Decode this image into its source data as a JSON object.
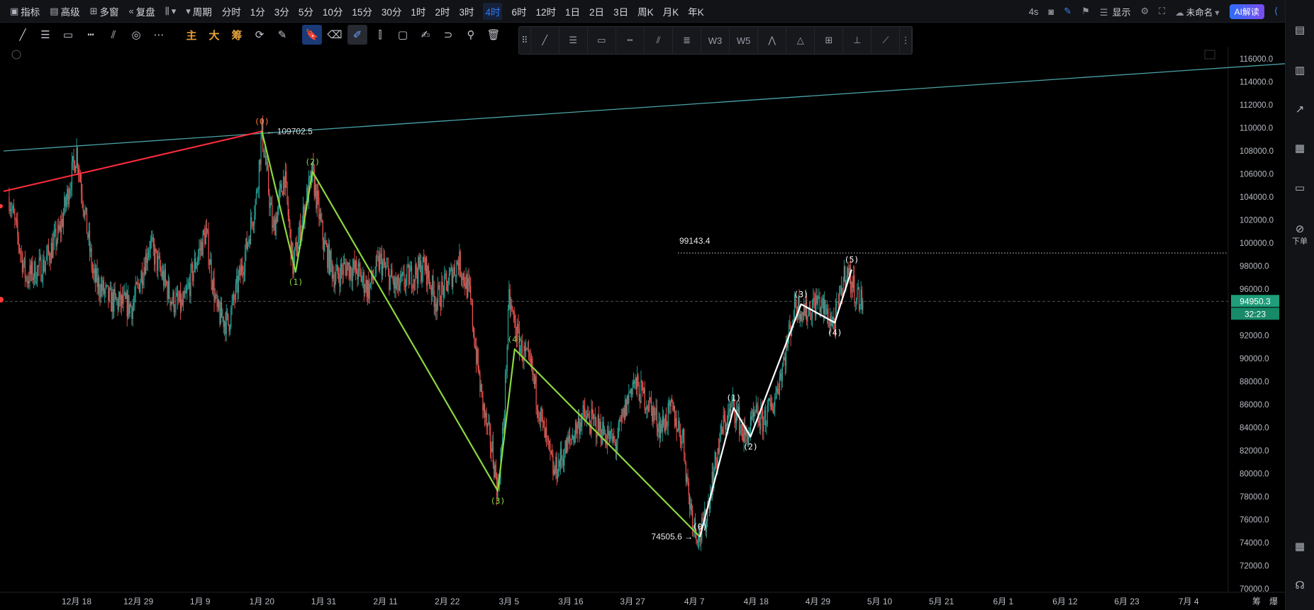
{
  "topbar": {
    "left_items": [
      {
        "icon": "indicator-icon",
        "label": "指标"
      },
      {
        "icon": "calendar-icon",
        "label": "高级"
      },
      {
        "icon": "grid-icon",
        "label": "多窗"
      },
      {
        "icon": "rewind-icon",
        "label": "复盘"
      },
      {
        "icon": "candle-type-icon",
        "label": ""
      },
      {
        "icon": "chevron-down-icon",
        "label": "周期"
      }
    ],
    "periods": [
      "分时",
      "1分",
      "3分",
      "5分",
      "10分",
      "15分",
      "30分",
      "1时",
      "2时",
      "3时",
      "4时",
      "6时",
      "12时",
      "1日",
      "2日",
      "3日",
      "周K",
      "月K",
      "年K"
    ],
    "active_period": "4时",
    "right": {
      "countdown": "4s",
      "display_label": "显示",
      "layout_name": "未命名",
      "ai_label": "AI解读"
    }
  },
  "toolbar": {
    "text_tools": [
      "主",
      "大",
      "筹"
    ],
    "icons": [
      "line-icon",
      "horizontal-lines-icon",
      "rectangle-icon",
      "ruler-icon",
      "fib-icon",
      "spiral-icon",
      "more-icon",
      "cycle-icon",
      "pen-icon",
      "bookmark-icon",
      "eraser-icon",
      "brush-icon",
      "bars-icon",
      "clipboard-icon",
      "note-icon",
      "magnet-icon",
      "filter-icon",
      "trash-icon"
    ]
  },
  "draw_panel": {
    "tools": [
      "drag-handle-icon",
      "trend-line-icon",
      "parallel-lines-icon",
      "rectangle-icon",
      "price-range-icon",
      "fib-retracement-icon",
      "fib-levels-icon",
      "wave3-icon",
      "wave5-icon",
      "pattern-icon",
      "triangle-icon",
      "crosshair-box-icon",
      "measure-icon",
      "ray-icon",
      "panel-more-icon"
    ]
  },
  "sidebar": {
    "items": [
      {
        "icon": "layout-icon",
        "label": ""
      },
      {
        "icon": "bar-chart-icon",
        "label": ""
      },
      {
        "icon": "trend-icon",
        "label": ""
      },
      {
        "icon": "chart-box-icon",
        "label": ""
      },
      {
        "icon": "depth-icon",
        "label": ""
      },
      {
        "icon": "order-icon",
        "label": "下单"
      },
      {
        "icon": "panel-icon",
        "label": ""
      },
      {
        "icon": "headset-icon",
        "label": ""
      }
    ]
  },
  "colors": {
    "up": "#26a69a",
    "down": "#ef5350",
    "green_wave": "#8bd83f",
    "white_wave": "#ffffff",
    "trend_red": "#ff2d3d",
    "trend_teal": "#4aa3a8",
    "price_badge": "#1f9e7a"
  },
  "chart_data": {
    "type": "candlestick",
    "ylim": [
      70000,
      116000
    ],
    "y_ticks": [
      70000,
      72000,
      74000,
      76000,
      78000,
      80000,
      82000,
      84000,
      86000,
      88000,
      90000,
      92000,
      94000,
      96000,
      98000,
      100000,
      102000,
      104000,
      106000,
      108000,
      110000,
      112000,
      114000,
      116000
    ],
    "x_ticks": [
      {
        "label": "12月 18",
        "day": 0
      },
      {
        "label": "12月 29",
        "day": 11
      },
      {
        "label": "1月 9",
        "day": 22
      },
      {
        "label": "1月 20",
        "day": 33
      },
      {
        "label": "1月 31",
        "day": 44
      },
      {
        "label": "2月 11",
        "day": 55
      },
      {
        "label": "2月 22",
        "day": 66
      },
      {
        "label": "3月 5",
        "day": 77
      },
      {
        "label": "3月 16",
        "day": 88
      },
      {
        "label": "3月 27",
        "day": 99
      },
      {
        "label": "4月 7",
        "day": 110
      },
      {
        "label": "4月 18",
        "day": 121
      },
      {
        "label": "4月 29",
        "day": 132
      },
      {
        "label": "5月 10",
        "day": 143
      },
      {
        "label": "5月 21",
        "day": 154
      },
      {
        "label": "6月 1",
        "day": 165
      },
      {
        "label": "6月 12",
        "day": 176
      },
      {
        "label": "6月 23",
        "day": 187
      },
      {
        "label": "7月 4",
        "day": 198
      }
    ],
    "x_extra_labels": [
      "筹",
      "爆"
    ],
    "price_path": [
      [
        -12,
        104000
      ],
      [
        -9,
        97000
      ],
      [
        -6,
        98000
      ],
      [
        -3,
        101000
      ],
      [
        0,
        108000
      ],
      [
        3,
        97000
      ],
      [
        6,
        95000
      ],
      [
        10,
        94500
      ],
      [
        13,
        100000
      ],
      [
        17,
        95000
      ],
      [
        19,
        94500
      ],
      [
        21,
        98000
      ],
      [
        23,
        101000
      ],
      [
        25,
        94000
      ],
      [
        27,
        93000
      ],
      [
        30,
        99000
      ],
      [
        32,
        104000
      ],
      [
        33,
        109702
      ],
      [
        35,
        101000
      ],
      [
        37,
        106000
      ],
      [
        38.5,
        98000
      ],
      [
        41,
        104000
      ],
      [
        42,
        106000
      ],
      [
        44,
        100000
      ],
      [
        46,
        97000
      ],
      [
        48,
        98000
      ],
      [
        50,
        97500
      ],
      [
        52,
        96000
      ],
      [
        54,
        98500
      ],
      [
        57,
        96000
      ],
      [
        59,
        97000
      ],
      [
        62,
        98000
      ],
      [
        64,
        95000
      ],
      [
        66,
        96500
      ],
      [
        68,
        98500
      ],
      [
        70,
        95500
      ],
      [
        71,
        91000
      ],
      [
        72,
        87000
      ],
      [
        73,
        84000
      ],
      [
        74,
        82000
      ],
      [
        75,
        78500
      ],
      [
        76,
        84000
      ],
      [
        77,
        95000
      ],
      [
        79,
        91000
      ],
      [
        81,
        89000
      ],
      [
        83,
        84000
      ],
      [
        85,
        80000
      ],
      [
        87,
        82000
      ],
      [
        90,
        85000
      ],
      [
        93,
        84000
      ],
      [
        96,
        82500
      ],
      [
        99,
        88000
      ],
      [
        102,
        86000
      ],
      [
        104,
        84000
      ],
      [
        106,
        85500
      ],
      [
        108,
        83000
      ],
      [
        109,
        78000
      ],
      [
        110,
        75500
      ],
      [
        111,
        74506
      ],
      [
        112,
        76000
      ],
      [
        113,
        79000
      ],
      [
        115,
        84000
      ],
      [
        117,
        86000
      ],
      [
        119,
        83000
      ],
      [
        121,
        85000
      ],
      [
        122,
        84500
      ],
      [
        124,
        86000
      ],
      [
        126,
        90000
      ],
      [
        127,
        92500
      ],
      [
        128,
        94700
      ],
      [
        130,
        94000
      ],
      [
        132,
        95000
      ],
      [
        134,
        93500
      ],
      [
        135,
        93000
      ],
      [
        136,
        95500
      ],
      [
        137,
        97800
      ],
      [
        138,
        96500
      ],
      [
        139.5,
        95000
      ],
      [
        140,
        94950
      ]
    ],
    "current_price": "94950.3",
    "countdown": "32:23",
    "resistance_label": "99143.4",
    "resistance_price": 99143.4,
    "high_label": "109702.5",
    "low_label": "74505.6",
    "trend_lines": [
      {
        "color": "#4aa3a8",
        "from": [
          -13,
          108000
        ],
        "to": [
          228,
          116000
        ]
      },
      {
        "color": "#ff2d3d",
        "from": [
          -13,
          104500
        ],
        "to": [
          33,
          109702
        ]
      }
    ],
    "wave_green": {
      "points": [
        [
          33,
          109702
        ],
        [
          39,
          97500
        ],
        [
          42,
          106200
        ],
        [
          75,
          78500
        ],
        [
          78,
          90800
        ],
        [
          111,
          74506
        ]
      ],
      "labels": [
        "(0)",
        "(1)",
        "(2)",
        "(3)",
        "(4)",
        ""
      ]
    },
    "wave_white": {
      "points": [
        [
          111,
          74506
        ],
        [
          117,
          85700
        ],
        [
          120,
          83200
        ],
        [
          129,
          94700
        ],
        [
          135,
          93100
        ],
        [
          138,
          97700
        ]
      ],
      "labels": [
        "(0)",
        "(1)",
        "(2)",
        "(3)",
        "(4)",
        "(5)"
      ]
    }
  }
}
